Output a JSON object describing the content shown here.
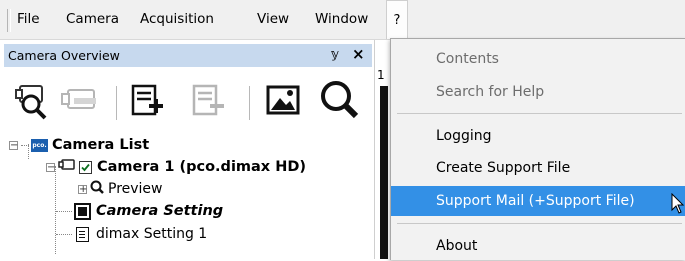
{
  "menubar": {
    "items": [
      "File",
      "Camera",
      "Acquisition",
      "View",
      "Window"
    ],
    "help_label": "?"
  },
  "panel": {
    "title": "Camera Overview",
    "pin": "ₐ",
    "close": "✕"
  },
  "toolbar": {
    "icons": [
      "find-camera-icon",
      "disconnect-camera-icon",
      "add-setting-icon",
      "remove-setting-icon",
      "image-icon",
      "zoom-icon"
    ]
  },
  "tree": {
    "root_label": "Camera List",
    "logo_text": "pco.",
    "camera_label": "Camera 1 (pco.dimax HD)",
    "camera_checked": true,
    "preview_label": "Preview",
    "camera_setting_label": "Camera Setting",
    "dimax_setting_label": "dimax Setting 1"
  },
  "middle": {
    "tab_text": "1"
  },
  "dropdown": {
    "items": [
      {
        "label": "Contents",
        "disabled": true
      },
      {
        "label": "Search for Help",
        "disabled": true
      },
      {
        "label": "Logging",
        "disabled": false
      },
      {
        "label": "Create Support File",
        "disabled": false
      },
      {
        "label": "Support Mail (+Support File)",
        "disabled": false,
        "highlighted": true
      },
      {
        "label": "About",
        "disabled": false
      }
    ]
  },
  "colors": {
    "highlight": "#3390e6",
    "panel_header": "#c7d9ee"
  }
}
